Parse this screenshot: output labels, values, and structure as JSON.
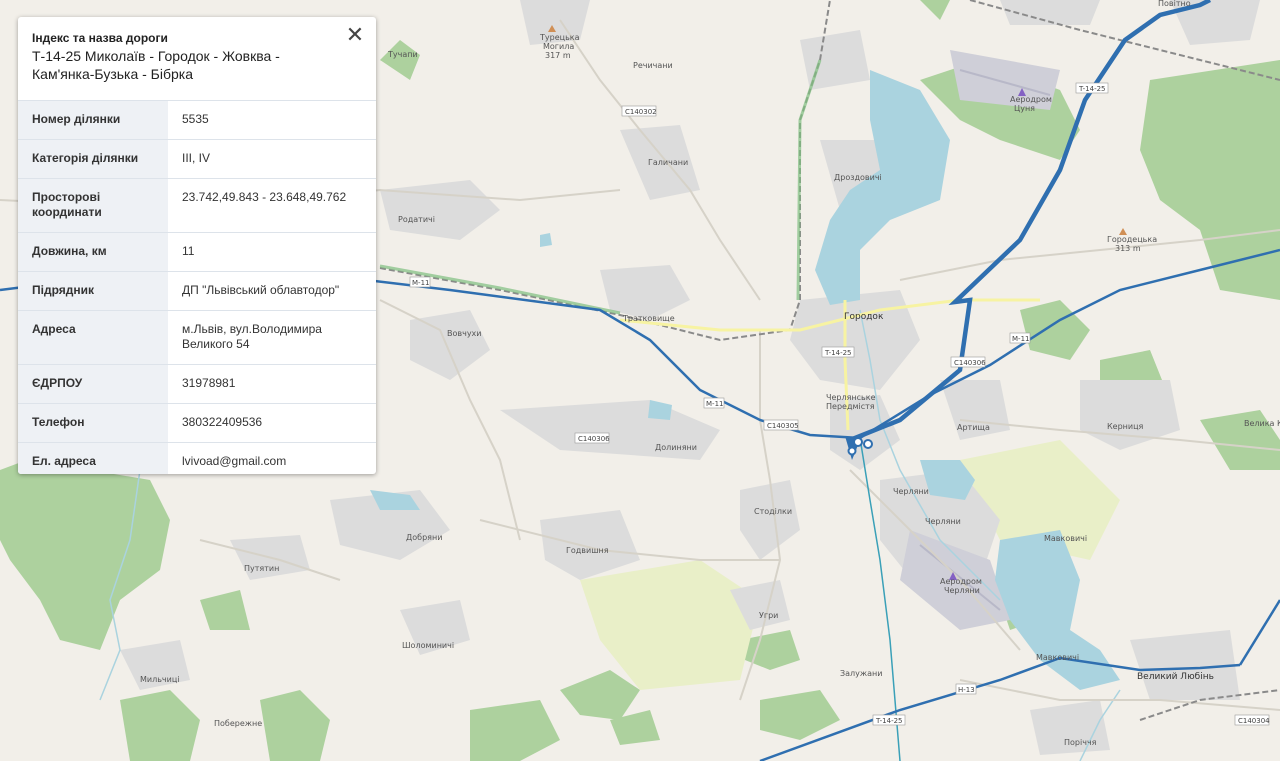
{
  "panel": {
    "label": "Індекс та назва дороги",
    "title": "Т-14-25 Миколаїв - Городок - Жовква - Кам'янка-Бузька - Бібрка",
    "close": "✕",
    "rows": [
      {
        "key": "Номер ділянки",
        "value": "5535"
      },
      {
        "key": "Категорія ділянки",
        "value": "III, IV"
      },
      {
        "key": "Просторові координати",
        "value": "23.742,49.843 - 23.648,49.762"
      },
      {
        "key": "Довжина, км",
        "value": "11"
      },
      {
        "key": "Підрядник",
        "value": "ДП \"Львівський облавтодор\""
      },
      {
        "key": "Адреса",
        "value": "м.Львів, вул.Володимира Великого 54"
      },
      {
        "key": "ЄДРПОУ",
        "value": "31978981"
      },
      {
        "key": "Телефон",
        "value": "380322409536"
      },
      {
        "key": "Ел. адреса",
        "value": "lvivoad@gmail.com"
      }
    ]
  },
  "map": {
    "colors": {
      "land": "#f2efe9",
      "forest": "#add19e",
      "water": "#aad3df",
      "urban": "#dddddd",
      "road_line": "#3a74b0",
      "route_blue": "#2f6fb0",
      "teal_line": "#3aa0b8"
    },
    "places": {
      "tunapy": "Тучапи",
      "turetska": "Турецька",
      "mohyla": "Могила",
      "mohyla_h": "317 m",
      "rechychany": "Речичани",
      "povitno": "Повітно",
      "halychany": "Галичани",
      "drozdovychi": "Дроздовичі",
      "airport1a": "Аеродром",
      "airport1b": "Цуня",
      "horodetska": "Городецька",
      "horodetska_h": "313 m",
      "rodatychi": "Родатичі",
      "tratkovyshe": "Тратковище",
      "horodok": "Городок",
      "vovchukhy": "Вовчухи",
      "cheliv1": "Черлянське",
      "cheliv2": "Передмістя",
      "artyshcha": "Артища",
      "kernytsia": "Керниця",
      "velykaka": "Велика Ка",
      "dolyniany": "Долиняни",
      "chervona": "Черляни",
      "cherliany": "Черляни",
      "mavkovychi": "Мавковичі",
      "stodilky": "Стоділки",
      "dobriany": "Добряни",
      "hodvyshnia": "Годвишня",
      "putiatyn": "Путятин",
      "airport2a": "Аеродром",
      "airport2b": "Черляни",
      "uhry": "Угри",
      "shchyrets": "Шоломиничі",
      "zaluzhany": "Залужани",
      "velyky_lyuben": "Великий Любінь",
      "mylnytsia": "Мильчиці",
      "poberezhe": "Побережне",
      "porichchia": "Поріччя",
      "mavko2": "Мавковичі"
    },
    "shields": {
      "s_c140302": "C140302",
      "s_t1425a": "T-14-25",
      "s_t1425b": "T-14-25",
      "s_t1425c": "T-14-25",
      "s_c140306": "C140306",
      "s_c140305": "C140305",
      "s_c140306b": "C140306",
      "s_m11a": "M-11",
      "s_m11b": "M-11",
      "s_m11c": "M-11",
      "s_c140304": "C140304",
      "s_h13": "H-13"
    }
  }
}
